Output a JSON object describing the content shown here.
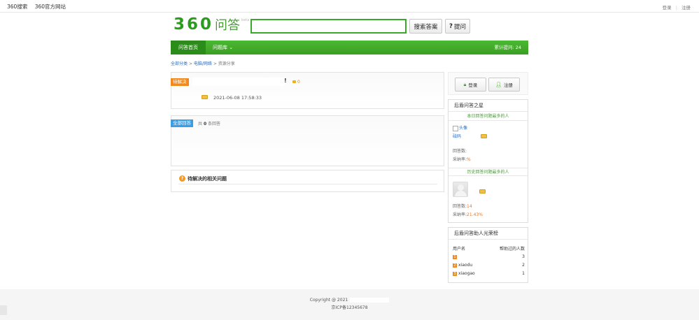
{
  "topbar": {
    "links": [
      "360搜索",
      "360官方网站"
    ],
    "login": "登录",
    "register": "注册"
  },
  "header": {
    "logo_num": "360",
    "logo_text": "问答",
    "logo_tag": "beta",
    "search_value": "",
    "search_button": "搜索答案",
    "ask_button_mark": "?",
    "ask_button": "提问"
  },
  "nav": {
    "home": "问答首页",
    "library": "问题库",
    "library_arrow": "⌄",
    "stat_label": "累计提问:",
    "stat_value": "24"
  },
  "breadcrumb": {
    "items": [
      "全部分类",
      "电脑/网络",
      "资源分享"
    ],
    "separator": ">"
  },
  "question": {
    "status": "待解决",
    "excl": "!",
    "reward": "0",
    "time": "2021-06-08 17:58:33"
  },
  "answers": {
    "label": "全部回答",
    "count_prefix": "共",
    "count": "0",
    "count_suffix": "条回答"
  },
  "related": {
    "icon": "?",
    "title": "待解决的相关问题"
  },
  "auth": {
    "login": "登录",
    "register": "注册"
  },
  "stars": {
    "title": "后盾问答之星",
    "this_month": "本日回答问题最多的人",
    "avatar_alt": "头像",
    "profile_label": "砝码",
    "answers_label": "回答数:",
    "answers_value": "",
    "adopt_label": "采纳率:",
    "adopt_value": "%",
    "history": "历史回答问题最多的人",
    "hist_answers_value": "14",
    "hist_adopt_value": "21.43%"
  },
  "leaderboard": {
    "title": "后盾问答助人光荣榜",
    "col_user": "用户名",
    "col_help": "帮助过的人数",
    "rows": [
      {
        "rank": "1",
        "name": "",
        "count": "3"
      },
      {
        "rank": "2",
        "name": "xiaodu",
        "count": "2"
      },
      {
        "rank": "3",
        "name": "xiaogao",
        "count": "1"
      }
    ]
  },
  "footer": {
    "copyright": "Copyright @ 2021",
    "icp": "京ICP备12345678"
  },
  "colors": {
    "brand_green": "#3a9f24",
    "accent_orange": "#f08a1e",
    "link_blue": "#2a6cbf"
  }
}
